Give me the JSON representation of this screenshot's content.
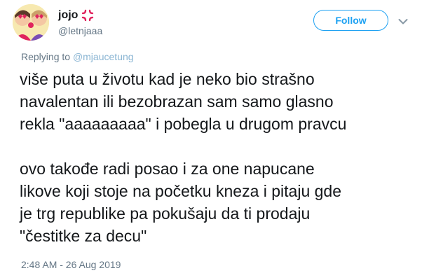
{
  "user": {
    "display_name": "jojo",
    "handle": "@letnjaaa",
    "avatar": "anime-style-avatar-with-heart-eyes",
    "badge_icon": "anger-symbol-icon"
  },
  "actions": {
    "follow_label": "Follow",
    "more_icon": "chevron-down-icon"
  },
  "reply": {
    "prefix": "Replying to ",
    "mention": "@mjaucetung"
  },
  "tweet": {
    "text": "više puta u životu kad je neko bio strašno\nnavalentan ili bezobrazan sam samo glasno\nrekla \"aaaaaaaaa\" i pobegla u drugom pravcu\n\novo takođe radi posao i za one napucane\nlikove koji stoje na početku kneza i pitaju gde\nje trg republike pa pokušaju da ti prodaju\n\"čestitke za decu\"",
    "timestamp": "2:48 AM - 26 Aug 2019"
  },
  "colors": {
    "accent": "#1da1f2",
    "secondary_text": "#657786",
    "primary_text": "#14171a",
    "anger_red": "#e0245e"
  }
}
